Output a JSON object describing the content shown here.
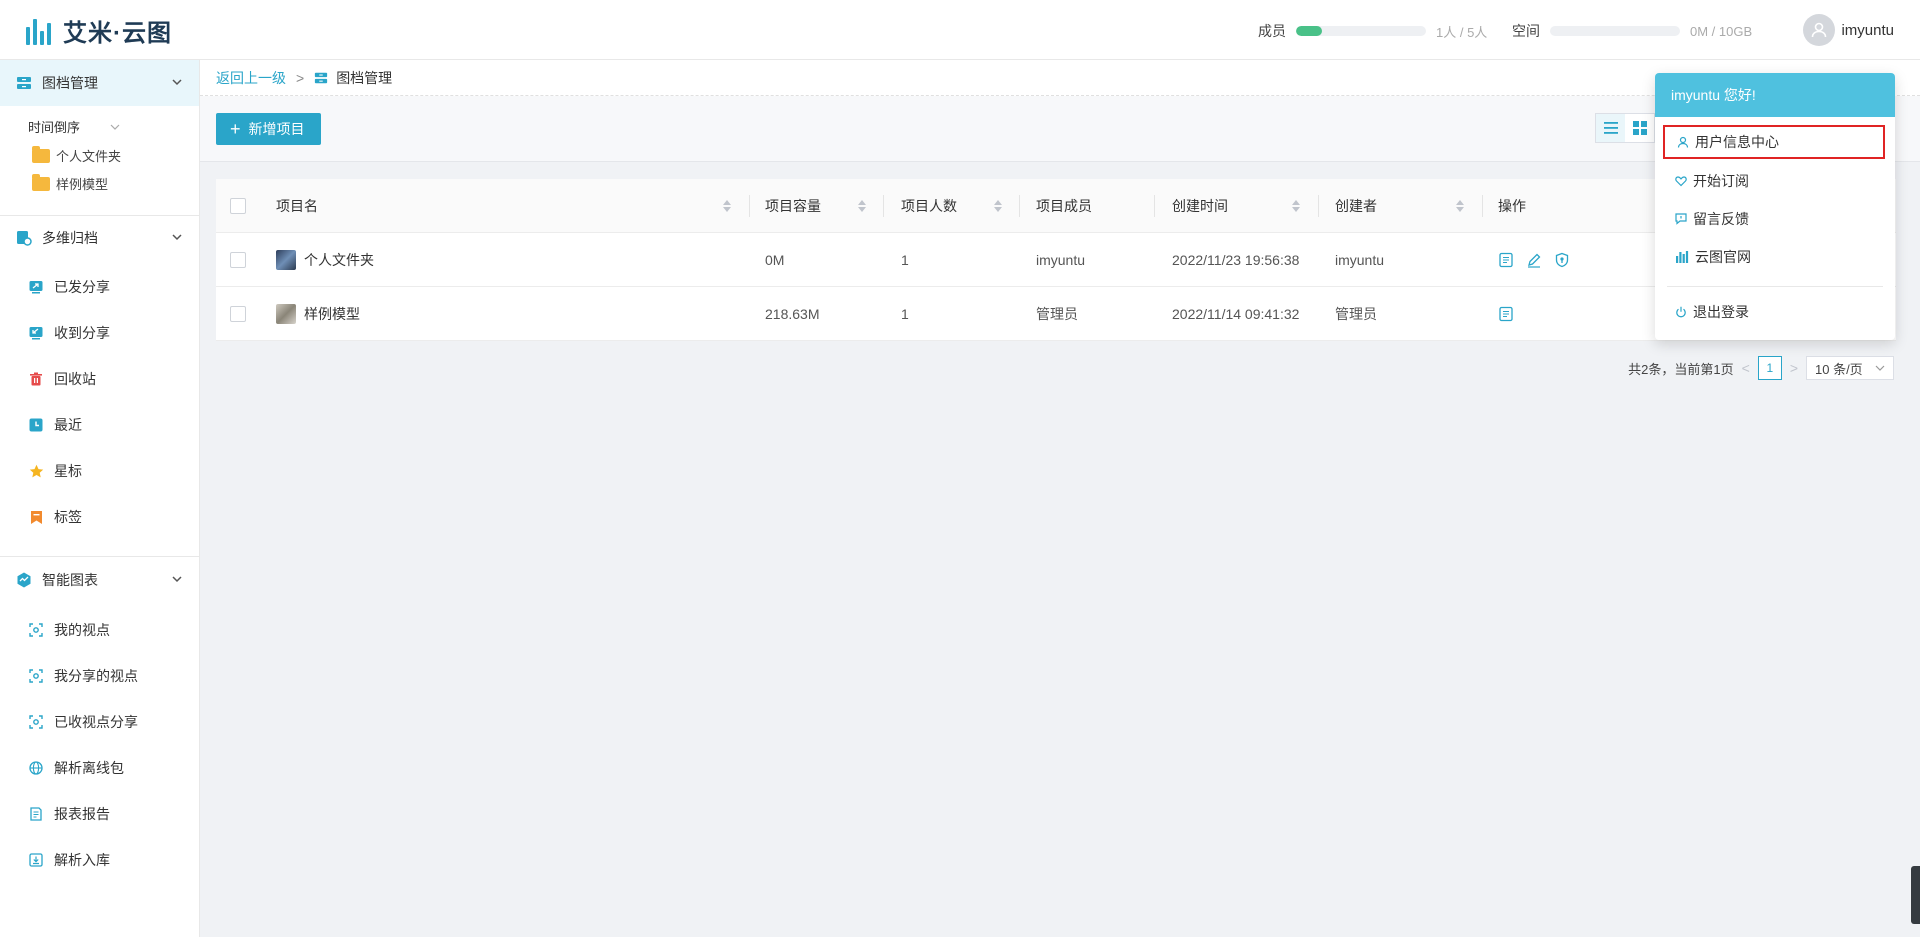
{
  "app": {
    "logo_text": "艾米·云图"
  },
  "header": {
    "members_label": "成员",
    "members_value": "1人 / 5人",
    "members_fraction": 0.2,
    "space_label": "空间",
    "space_value": "0M / 10GB",
    "space_fraction": 0,
    "username": "imyuntu"
  },
  "sidebar": {
    "sections": [
      {
        "label": "图档管理"
      },
      {
        "label": "多维归档"
      },
      {
        "label": "智能图表"
      }
    ],
    "tree": {
      "sort_label": "时间倒序",
      "folders": [
        "个人文件夹",
        "样例模型"
      ]
    },
    "archive_items": [
      {
        "label": "已发分享",
        "icon": "share-out-icon"
      },
      {
        "label": "收到分享",
        "icon": "share-in-icon"
      },
      {
        "label": "回收站",
        "icon": "trash-icon"
      },
      {
        "label": "最近",
        "icon": "clock-icon"
      },
      {
        "label": "星标",
        "icon": "star-icon"
      },
      {
        "label": "标签",
        "icon": "bookmark-icon"
      }
    ],
    "chart_items": [
      {
        "label": "我的视点",
        "icon": "viewpoint-icon"
      },
      {
        "label": "我分享的视点",
        "icon": "viewpoint-icon"
      },
      {
        "label": "已收视点分享",
        "icon": "viewpoint-icon"
      },
      {
        "label": "解析离线包",
        "icon": "globe-icon"
      },
      {
        "label": "报表报告",
        "icon": "report-icon"
      },
      {
        "label": "解析入库",
        "icon": "import-icon"
      }
    ]
  },
  "breadcrumb": {
    "back": "返回上一级",
    "separator": ">",
    "current": "图档管理"
  },
  "toolbar": {
    "add_label": "新增项目"
  },
  "table": {
    "columns": [
      "项目名",
      "项目容量",
      "项目人数",
      "项目成员",
      "创建时间",
      "创建者",
      "操作"
    ],
    "rows": [
      {
        "name": "个人文件夹",
        "size": "0M",
        "count": "1",
        "members": "imyuntu",
        "created": "2022/11/23 19:56:38",
        "creator": "imyuntu"
      },
      {
        "name": "样例模型",
        "size": "218.63M",
        "count": "1",
        "members": "管理员",
        "created": "2022/11/14 09:41:32",
        "creator": "管理员"
      }
    ]
  },
  "pagination": {
    "summary": "共2条，当前第1页",
    "page": "1",
    "page_size": "10 条/页",
    "prev": "<",
    "next": ">"
  },
  "user_menu": {
    "greeting": "imyuntu 您好!",
    "items": [
      {
        "label": "用户信息中心",
        "icon": "user-icon"
      },
      {
        "label": "开始订阅",
        "icon": "heart-icon"
      },
      {
        "label": "留言反馈",
        "icon": "message-icon"
      },
      {
        "label": "云图官网",
        "icon": "website-icon"
      },
      {
        "label": "退出登录",
        "icon": "power-icon"
      }
    ]
  },
  "colors": {
    "accent": "#2aa5c9",
    "menu_header": "#4fc1df",
    "member_bar": "#49c188",
    "highlight": "#e02424"
  }
}
